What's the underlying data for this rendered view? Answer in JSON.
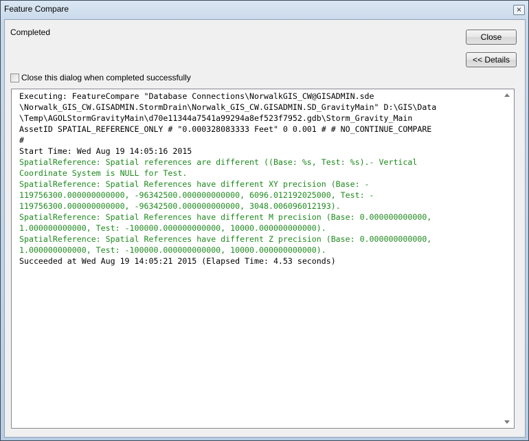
{
  "window": {
    "title": "Feature Compare",
    "close_glyph": "×"
  },
  "status_text": "Completed",
  "buttons": {
    "close_label": "Close",
    "details_label": "<< Details"
  },
  "checkbox": {
    "label": "Close this dialog when completed successfully",
    "checked": false
  },
  "log": {
    "lines": [
      {
        "text": "Executing: FeatureCompare \"Database Connections\\NorwalkGIS_CW@GISADMIN.sde",
        "color": "black"
      },
      {
        "text": "\\Norwalk_GIS_CW.GISADMIN.StormDrain\\Norwalk_GIS_CW.GISADMIN.SD_GravityMain\" D:\\GIS\\Data",
        "color": "black"
      },
      {
        "text": "\\Temp\\AGOLStormGravityMain\\d70e11344a7541a99294a8ef523f7952.gdb\\Storm_Gravity_Main",
        "color": "black"
      },
      {
        "text": "AssetID SPATIAL_REFERENCE_ONLY # \"0.000328083333 Feet\" 0 0.001 # # NO_CONTINUE_COMPARE",
        "color": "black"
      },
      {
        "text": "#",
        "color": "black"
      },
      {
        "text": "Start Time: Wed Aug 19 14:05:16 2015",
        "color": "black"
      },
      {
        "text": "SpatialReference: Spatial references are different ((Base: %s, Test: %s).- Vertical",
        "color": "green"
      },
      {
        "text": "Coordinate System is NULL for Test.",
        "color": "green"
      },
      {
        "text": "SpatialReference: Spatial References have different XY precision (Base: -",
        "color": "green"
      },
      {
        "text": "119756300.000000000000, -96342500.000000000000, 6096.012192025000, Test: -",
        "color": "green"
      },
      {
        "text": "119756300.000000000000, -96342500.000000000000, 3048.006096012193).",
        "color": "green"
      },
      {
        "text": "SpatialReference: Spatial References have different M precision (Base: 0.000000000000,",
        "color": "green"
      },
      {
        "text": "1.000000000000, Test: -100000.000000000000, 10000.000000000000).",
        "color": "green"
      },
      {
        "text": "SpatialReference: Spatial References have different Z precision (Base: 0.000000000000,",
        "color": "green"
      },
      {
        "text": "1.000000000000, Test: -100000.000000000000, 10000.000000000000).",
        "color": "green"
      },
      {
        "text": "Succeeded at Wed Aug 19 14:05:21 2015 (Elapsed Time: 4.53 seconds)",
        "color": "black"
      }
    ]
  },
  "icons": {
    "scroll_up": "scroll-up-arrow-icon",
    "scroll_down": "scroll-down-arrow-icon"
  },
  "colors": {
    "message_black": "#000000",
    "message_green": "#1d8a1d"
  }
}
